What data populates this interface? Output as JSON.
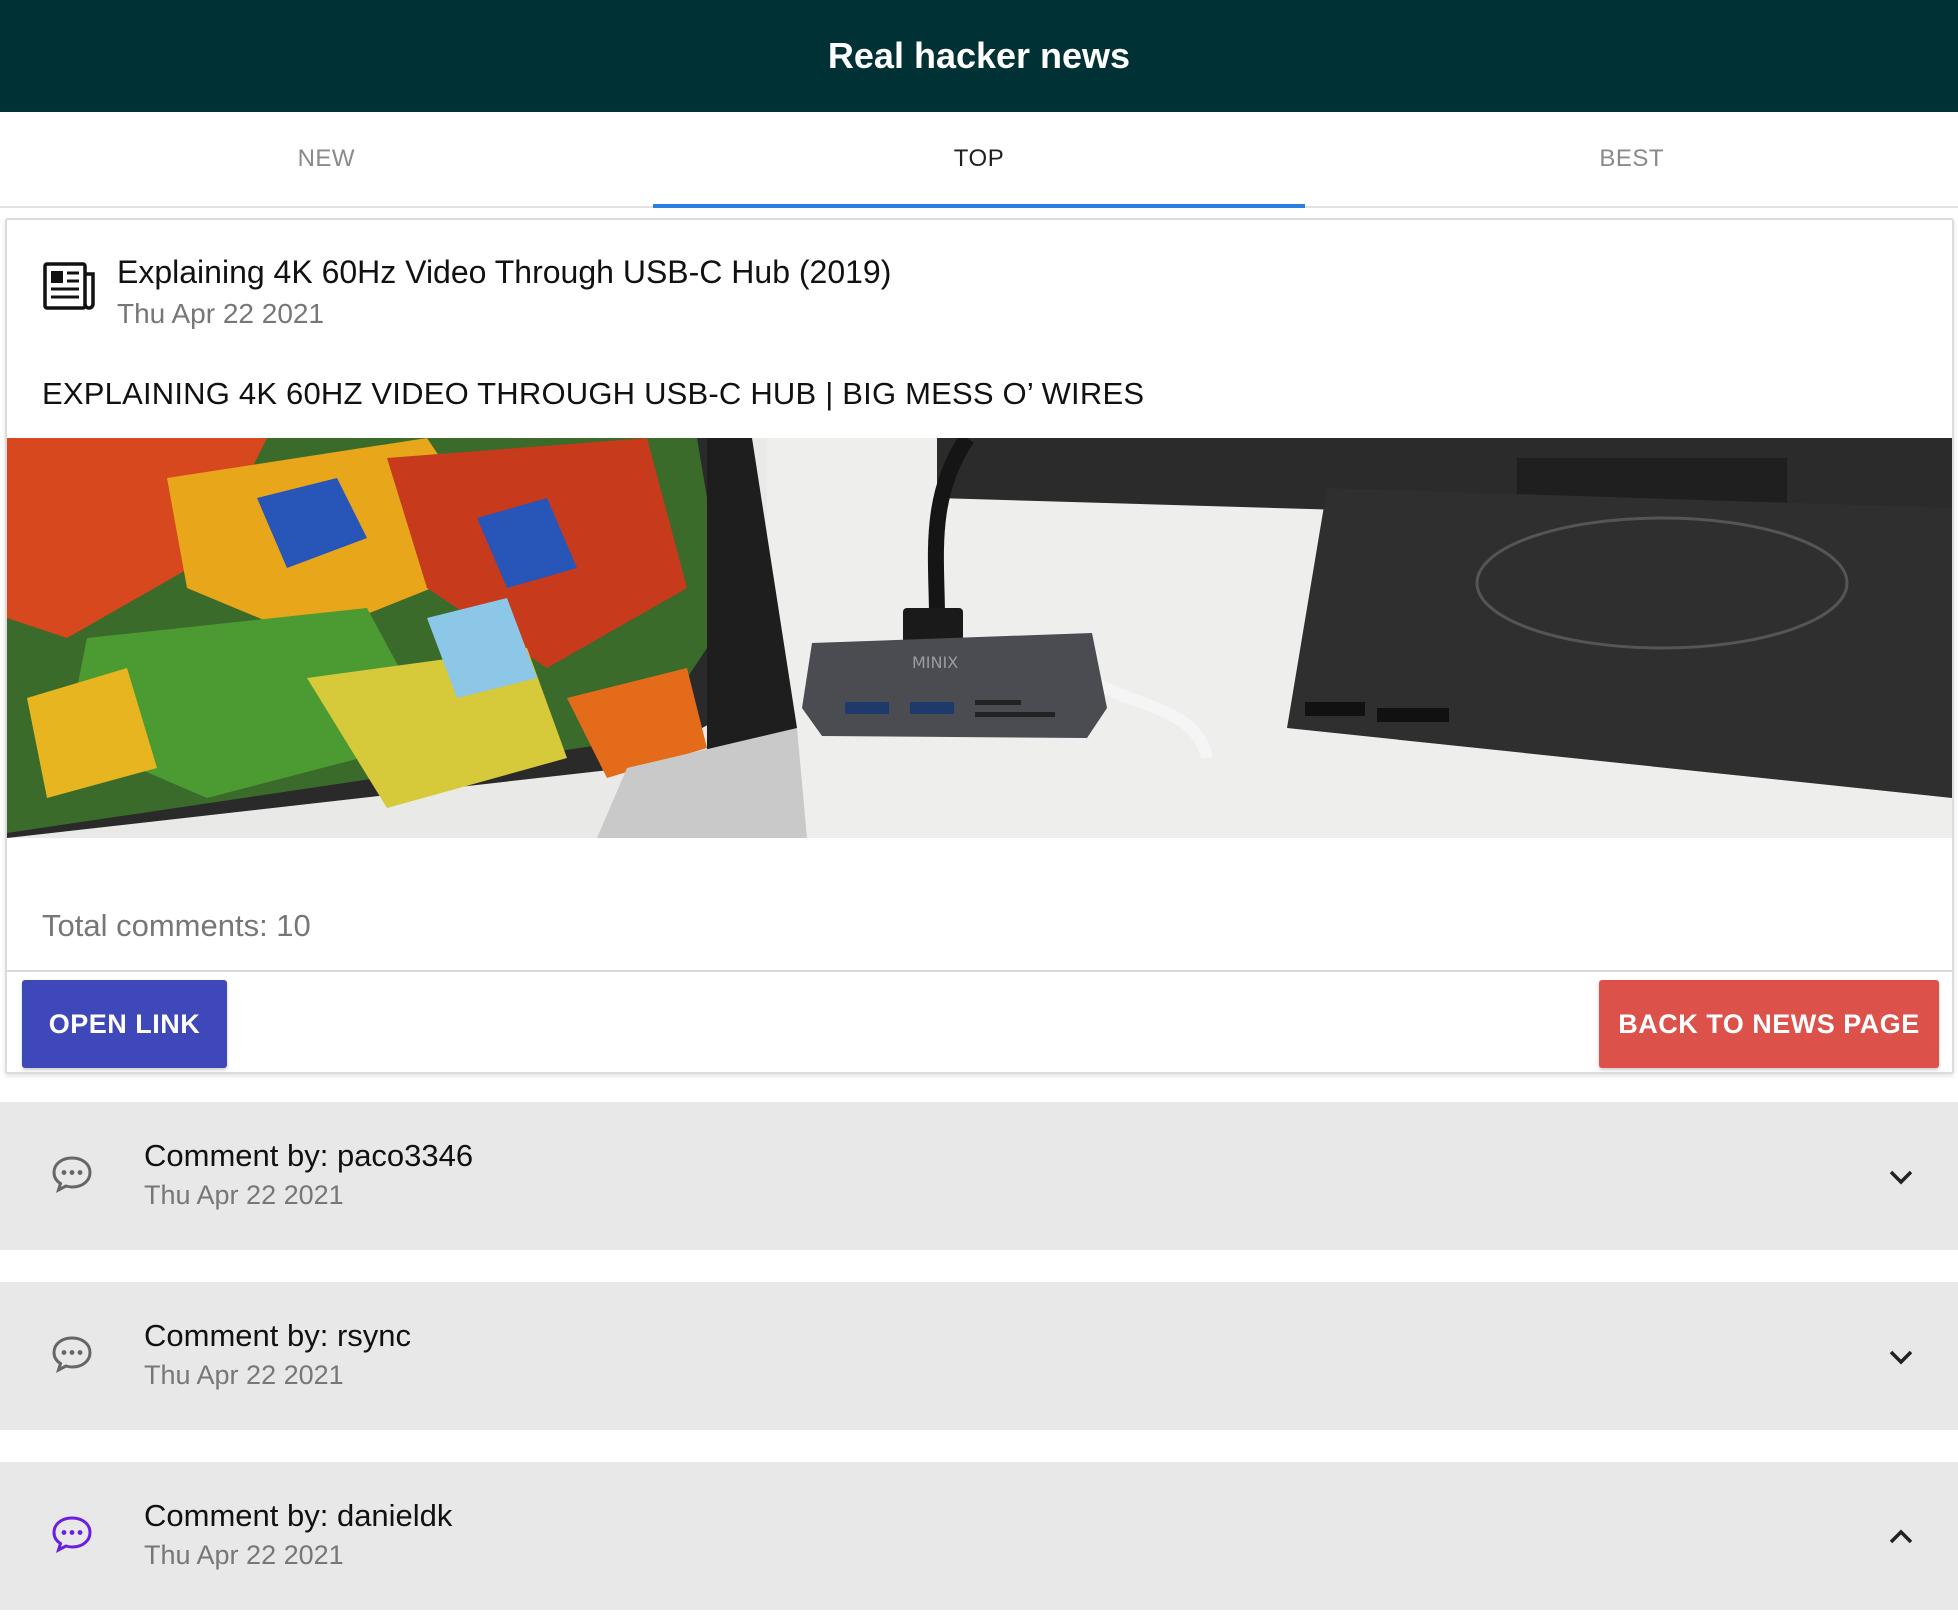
{
  "app": {
    "title": "Real hacker news"
  },
  "tabs": [
    {
      "label": "NEW",
      "active": false
    },
    {
      "label": "TOP",
      "active": true
    },
    {
      "label": "BEST",
      "active": false
    }
  ],
  "story": {
    "title": "Explaining 4K 60Hz Video Through USB-C Hub (2019)",
    "date": "Thu Apr 22 2021",
    "icon": "newspaper-icon",
    "preview_title": "EXPLAINING 4K 60HZ VIDEO THROUGH USB-C HUB | BIG MESS O’ WIRES",
    "preview_image_logo": "MINIX",
    "total_comments": "Total comments: 10",
    "open_link_label": "OPEN LINK",
    "back_label": "BACK TO NEWS PAGE"
  },
  "comments": [
    {
      "author": "Comment by: paco3346",
      "date": "Thu Apr 22 2021",
      "expanded": false,
      "icon": "comment-icon",
      "icon_color": "#666666",
      "chevron": "chevron-down-icon"
    },
    {
      "author": "Comment by: rsync",
      "date": "Thu Apr 22 2021",
      "expanded": false,
      "icon": "comment-icon",
      "icon_color": "#666666",
      "chevron": "chevron-down-icon"
    },
    {
      "author": "Comment by: danieldk",
      "date": "Thu Apr 22 2021",
      "expanded": true,
      "icon": "comment-icon",
      "icon_color": "#6a1ee0",
      "chevron": "chevron-up-icon"
    }
  ],
  "colors": {
    "appbar": "#003135",
    "tab_indicator": "#2b7de0",
    "open_button": "#3f48b9",
    "back_button": "#dc524b",
    "comment_bg": "#e8e8e8"
  }
}
